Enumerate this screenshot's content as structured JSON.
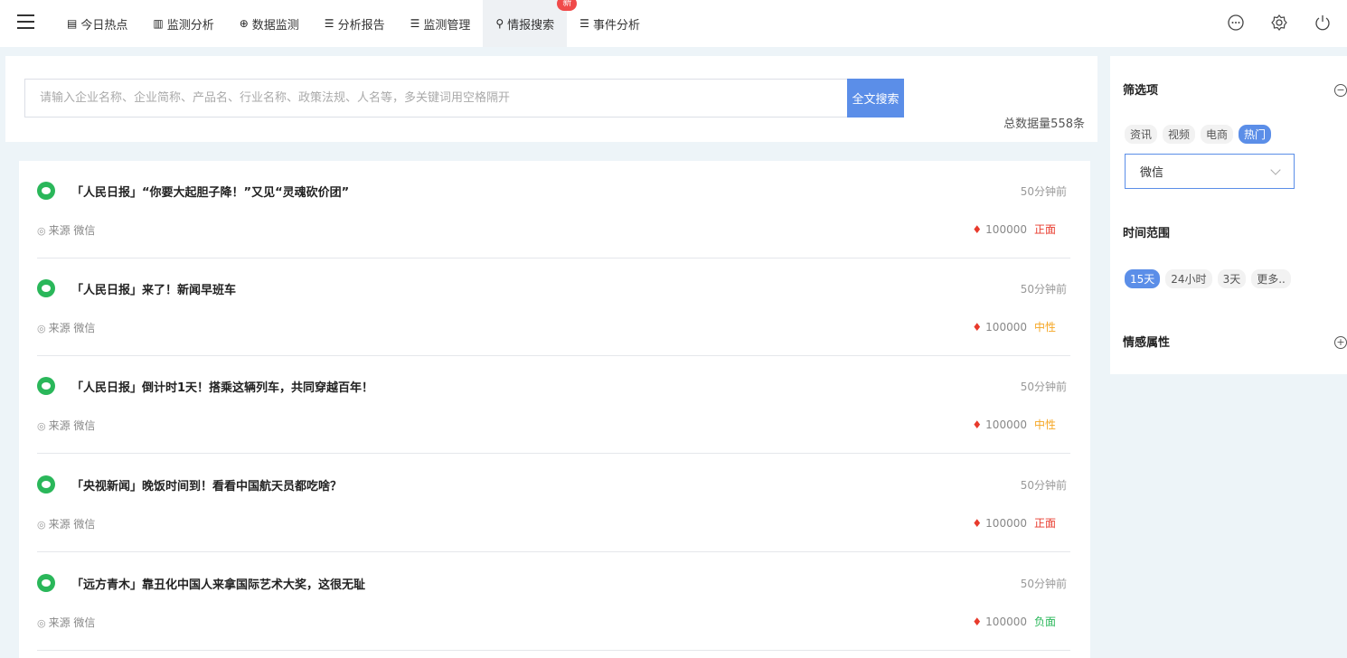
{
  "nav": {
    "items": [
      {
        "icon": "▤",
        "label": "今日热点"
      },
      {
        "icon": "▥",
        "label": "监测分析"
      },
      {
        "icon": "⊕",
        "label": "数据监测"
      },
      {
        "icon": "☰",
        "label": "分析报告"
      },
      {
        "icon": "☰",
        "label": "监测管理"
      },
      {
        "icon": "⚲",
        "label": "情报搜索",
        "badge": "新"
      },
      {
        "icon": "☰",
        "label": "事件分析"
      }
    ]
  },
  "search": {
    "placeholder": "请输入企业名称、企业简称、产品名、行业名称、政策法规、人名等，多关键词用空格隔开",
    "button": "全文搜索",
    "total": "总数据量558条"
  },
  "results": [
    {
      "title": "「人民日报」“你要大起胆子降！”又见“灵魂砍价团”",
      "time": "50分钟前",
      "source": "来源 微信",
      "heat": "100000",
      "sentiment": "正面",
      "sentiment_color": "#e83a2c"
    },
    {
      "title": "「人民日报」来了！新闻早班车",
      "time": "50分钟前",
      "source": "来源 微信",
      "heat": "100000",
      "sentiment": "中性",
      "sentiment_color": "#f5a623"
    },
    {
      "title": "「人民日报」倒计时1天！搭乘这辆列车，共同穿越百年！",
      "time": "50分钟前",
      "source": "来源 微信",
      "heat": "100000",
      "sentiment": "中性",
      "sentiment_color": "#f5a623"
    },
    {
      "title": "「央视新闻」晚饭时间到！看看中国航天员都吃啥？",
      "time": "50分钟前",
      "source": "来源 微信",
      "heat": "100000",
      "sentiment": "正面",
      "sentiment_color": "#e83a2c"
    },
    {
      "title": "「远方青木」靠丑化中国人来拿国际艺术大奖，这很无耻",
      "time": "50分钟前",
      "source": "来源 微信",
      "heat": "100000",
      "sentiment": "负面",
      "sentiment_color": "#2ab75a"
    }
  ],
  "filters": {
    "heading": "筛选项",
    "type_chips": [
      "资讯",
      "视频",
      "电商",
      "热门"
    ],
    "selected_source": "微信",
    "time_heading": "时间范围",
    "time_chips": [
      "15天",
      "24小时",
      "3天",
      "更多.."
    ],
    "sentiment_heading": "情感属性"
  }
}
